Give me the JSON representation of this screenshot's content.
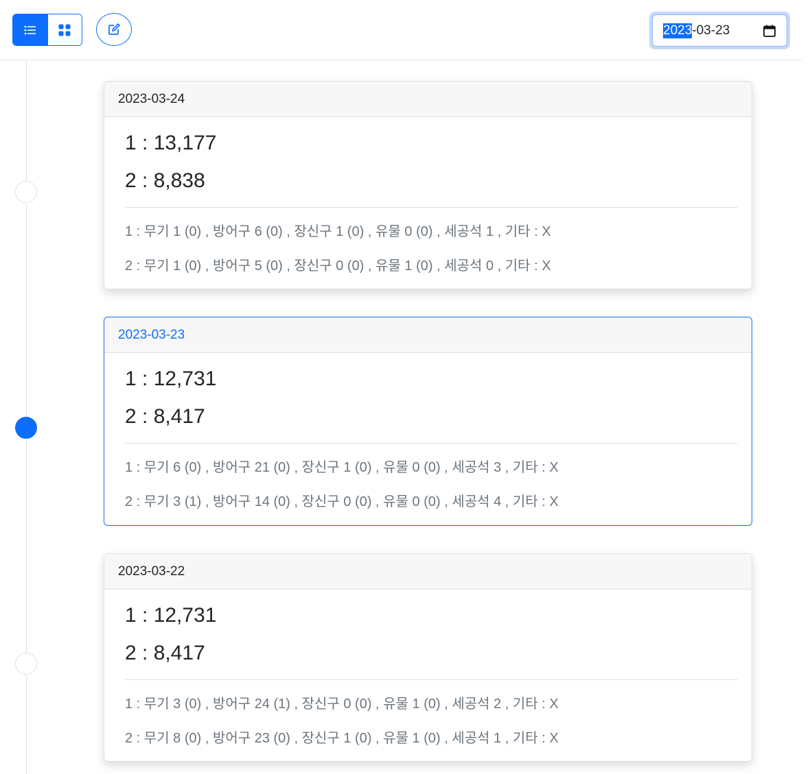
{
  "toolbar": {
    "date_value": "2023-03-23",
    "date_year_selected": "2023",
    "date_rest": "-03-23",
    "icons": {
      "list": "list-icon",
      "grid": "grid-icon",
      "edit": "edit-icon",
      "calendar": "calendar-icon"
    },
    "accent_color": "#0d6efd"
  },
  "cards": [
    {
      "date": "2023-03-24",
      "active": false,
      "line1": "1 : 13,177",
      "line2": "2 : 8,838",
      "detail1": "1 : 무기 1 (0) , 방어구 6 (0) , 장신구 1 (0) , 유물 0 (0) , 세공석 1 , 기타 : X",
      "detail2": "2 : 무기 1 (0) , 방어구 5 (0) , 장신구 0 (0) , 유물 1 (0) , 세공석 0 , 기타 : X"
    },
    {
      "date": "2023-03-23",
      "active": true,
      "line1": "1 : 12,731",
      "line2": "2 : 8,417",
      "detail1": "1 : 무기 6 (0) , 방어구 21 (0) , 장신구 1 (0) , 유물 0 (0) , 세공석 3 , 기타 : X",
      "detail2": "2 : 무기 3 (1) , 방어구 14 (0) , 장신구 0 (0) , 유물 0 (0) , 세공석 4 , 기타 : X"
    },
    {
      "date": "2023-03-22",
      "active": false,
      "line1": "1 : 12,731",
      "line2": "2 : 8,417",
      "detail1": "1 : 무기 3 (0) , 방어구 24 (1) , 장신구 0 (0) , 유물 1 (0) , 세공석 2 , 기타 : X",
      "detail2": "2 : 무기 8 (0) , 방어구 23 (0) , 장신구 1 (0) , 유물 1 (0) , 세공석 1 , 기타 : X"
    }
  ]
}
